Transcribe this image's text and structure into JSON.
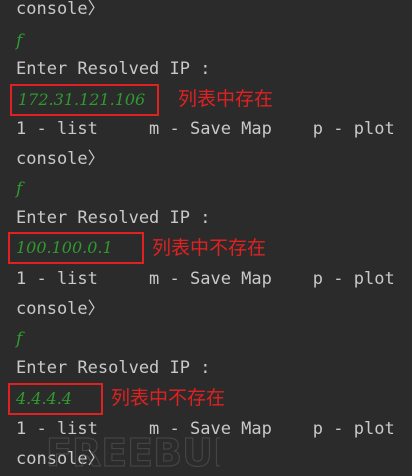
{
  "terminal": {
    "lines": {
      "l1": "console〉",
      "l2": "f",
      "l3": "Enter Resolved IP :",
      "l5": "1 - list     m - Save Map    p - plot",
      "l6": "console〉",
      "l7": "f",
      "l8": "Enter Resolved IP :",
      "l10": "1 - list     m - Save Map    p - plot",
      "l11": "console〉",
      "l12": "f",
      "l13": "Enter Resolved IP :",
      "l15": "1 - list     m - Save Map    p - plot",
      "l16": "console〉"
    },
    "entries": [
      {
        "ip": "172.31.121.106",
        "annotation": "列表中存在"
      },
      {
        "ip": "100.100.0.1",
        "annotation": "列表中不存在"
      },
      {
        "ip": "4.4.4.4",
        "annotation": "列表中不存在"
      }
    ]
  },
  "watermark": {
    "text": "FREEBUF",
    "color": "#5a5a5a"
  },
  "colors": {
    "background": "#2b2b2b",
    "text": "#c9c9c9",
    "input_green": "#2f9a2f",
    "annotation_red": "#e02121"
  }
}
